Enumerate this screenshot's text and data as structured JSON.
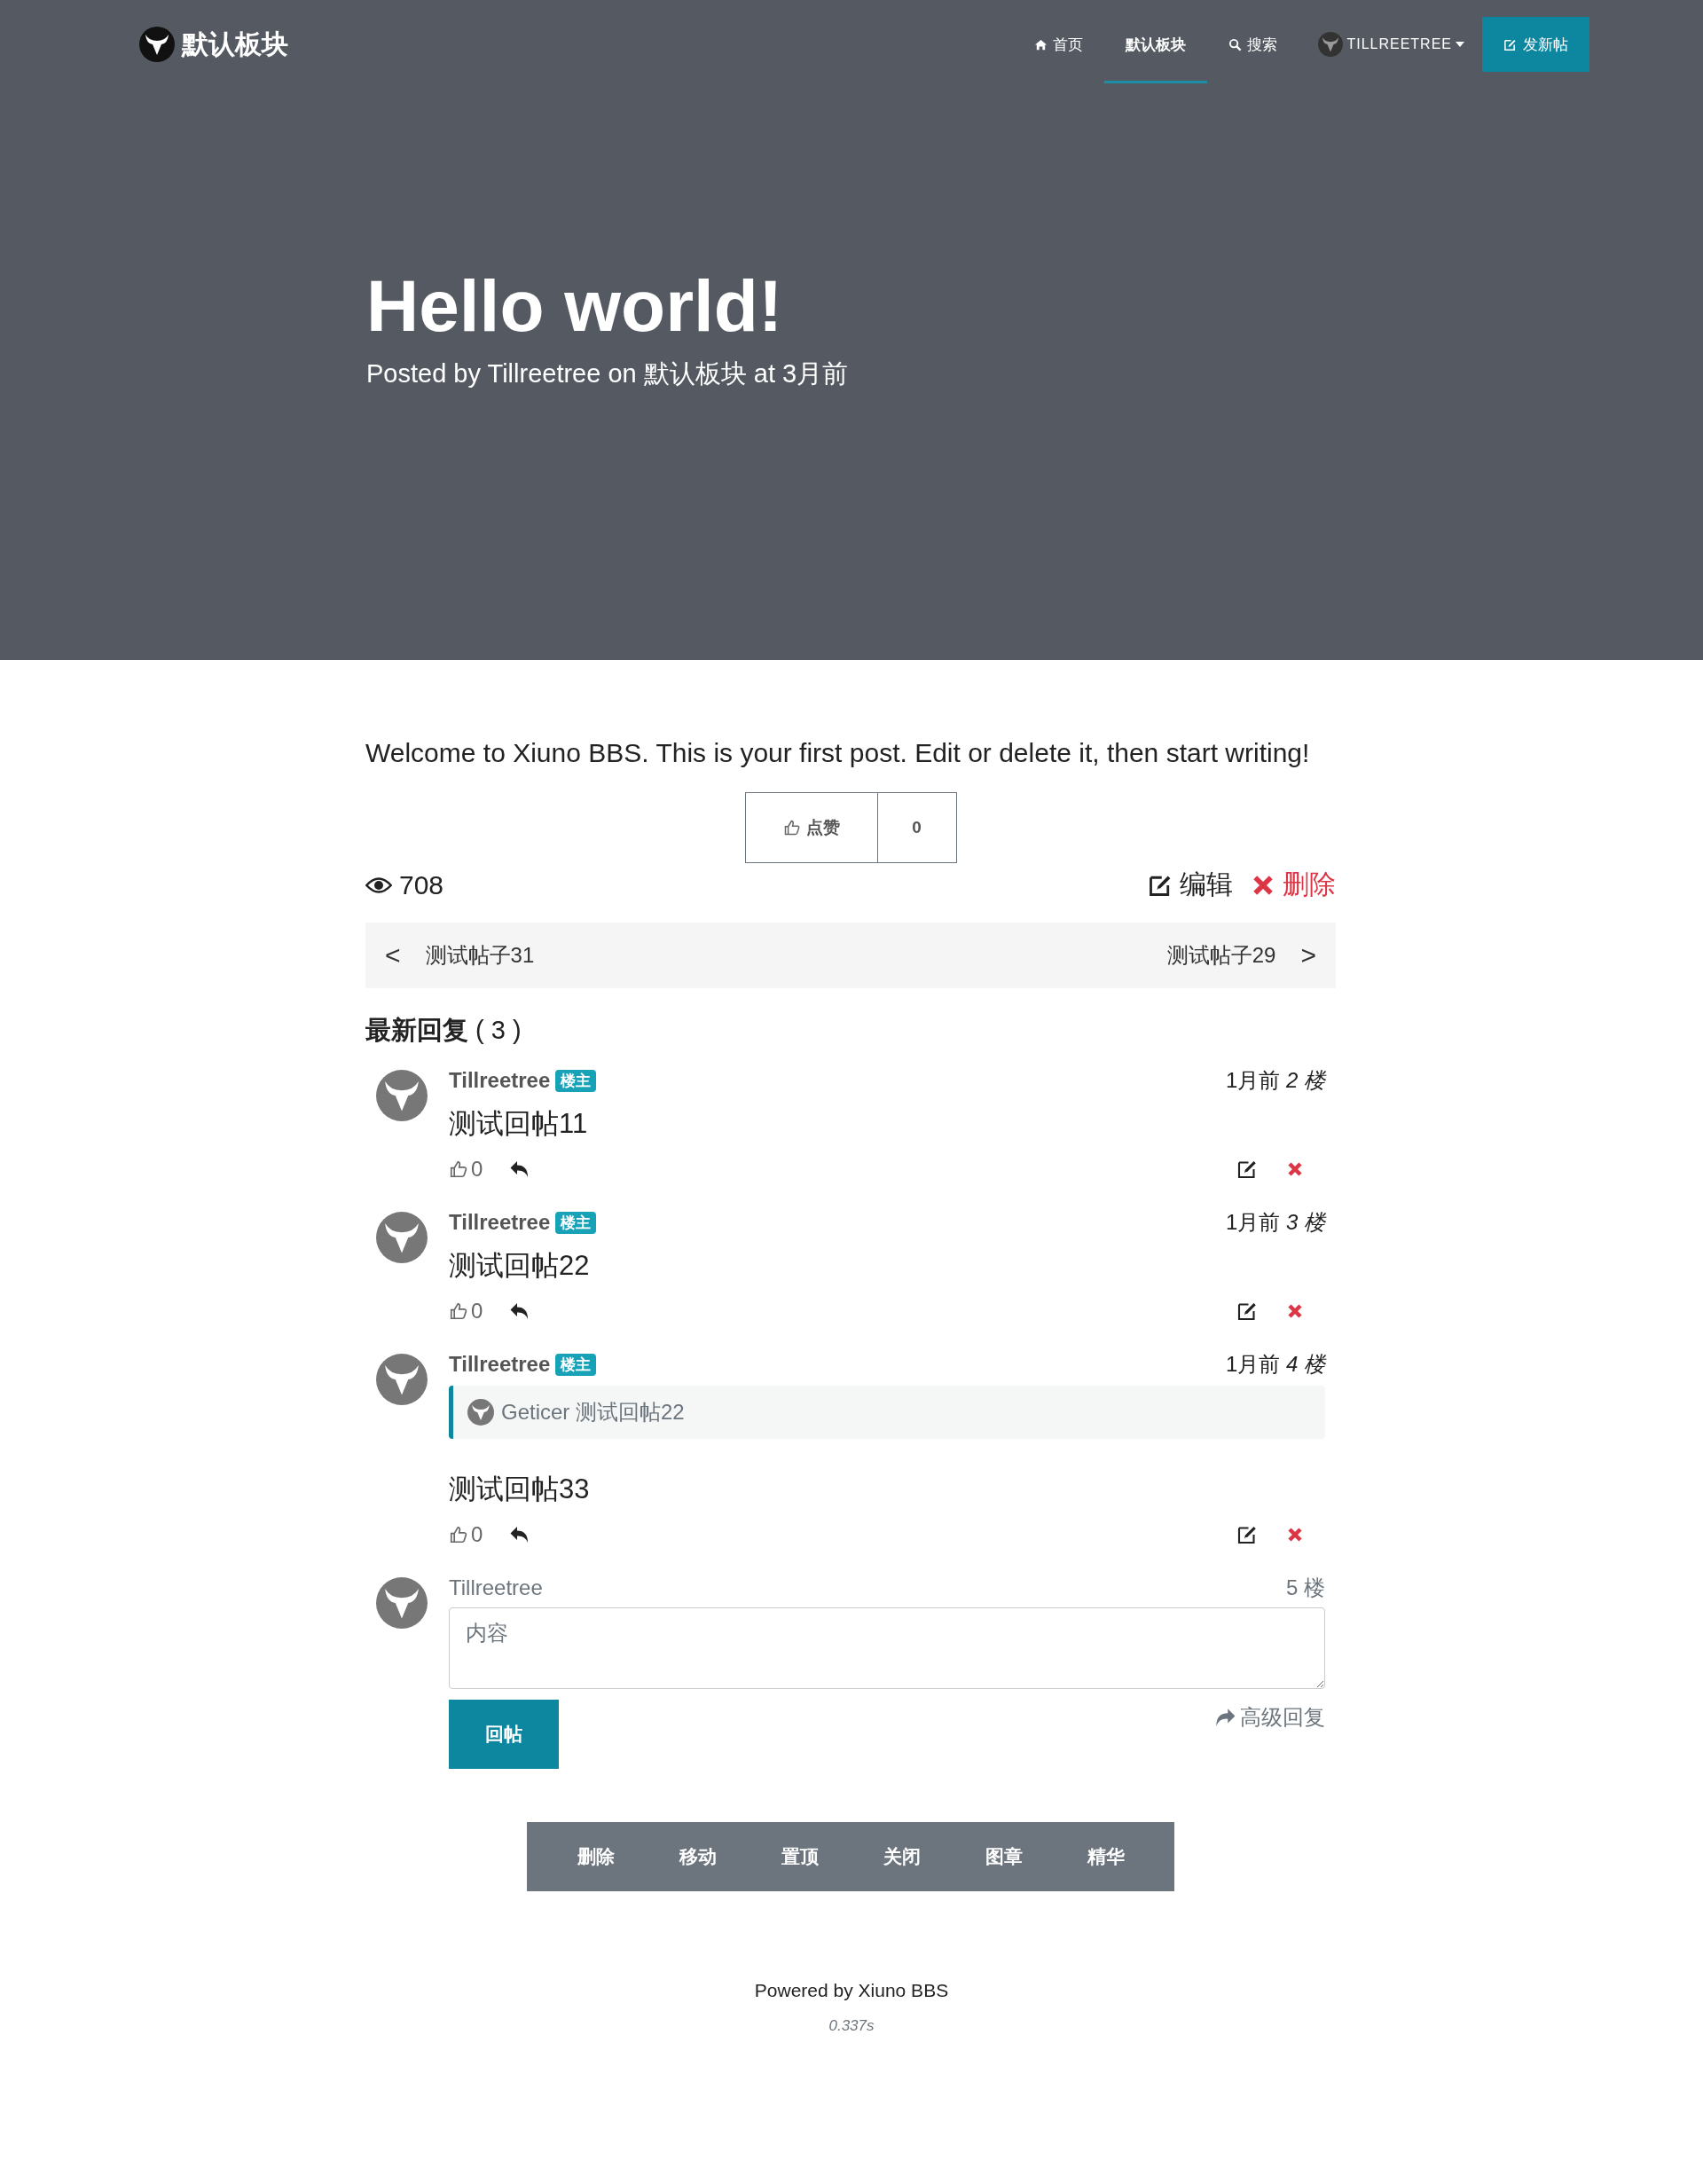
{
  "navbar": {
    "brand": "默认板块",
    "items": [
      {
        "kind": "home",
        "label": "首页",
        "selected": false
      },
      {
        "kind": "plain",
        "label": "默认板块",
        "selected": true
      },
      {
        "kind": "search",
        "label": "搜索",
        "selected": false
      }
    ],
    "user": "TILLREETREE",
    "new_post": "发新帖"
  },
  "hero": {
    "title": "Hello world!",
    "byline_parts": [
      "Posted by ",
      "Tillreetree",
      " on ",
      "默认板块",
      " at ",
      "3月前"
    ]
  },
  "post": {
    "body": "Welcome to Xiuno BBS. This is your first post. Edit or delete it, then start writing!",
    "like_label": "点赞",
    "like_count": "0",
    "views": "708",
    "edit": "编辑",
    "delete": "删除",
    "prev": "测试帖子31",
    "next": "测试帖子29",
    "prev_arrow": "<",
    "next_arrow": ">"
  },
  "replies": {
    "heading": "最新回复",
    "count": "( 3 )",
    "items": [
      {
        "name": "Tillreetree",
        "badge": "楼主",
        "time": "1月前",
        "floor": "2",
        "floor_unit": "楼",
        "content": "测试回帖11",
        "likes": "0"
      },
      {
        "name": "Tillreetree",
        "badge": "楼主",
        "time": "1月前",
        "floor": "3",
        "floor_unit": "楼",
        "content": "测试回帖22",
        "likes": "0"
      },
      {
        "name": "Tillreetree",
        "badge": "楼主",
        "time": "1月前",
        "floor": "4",
        "floor_unit": "楼",
        "quote": "Geticer 测试回帖22",
        "content": "测试回帖33",
        "likes": "0"
      }
    ]
  },
  "reply_form": {
    "name": "Tillreetree",
    "floor": "5 楼",
    "placeholder": "内容",
    "submit": "回帖",
    "advanced": "高级回复"
  },
  "mod_actions": [
    "删除",
    "移动",
    "置顶",
    "关闭",
    "图章",
    "精华"
  ],
  "footer": {
    "powered": "Powered by Xiuno BBS",
    "time": "0.337s"
  }
}
